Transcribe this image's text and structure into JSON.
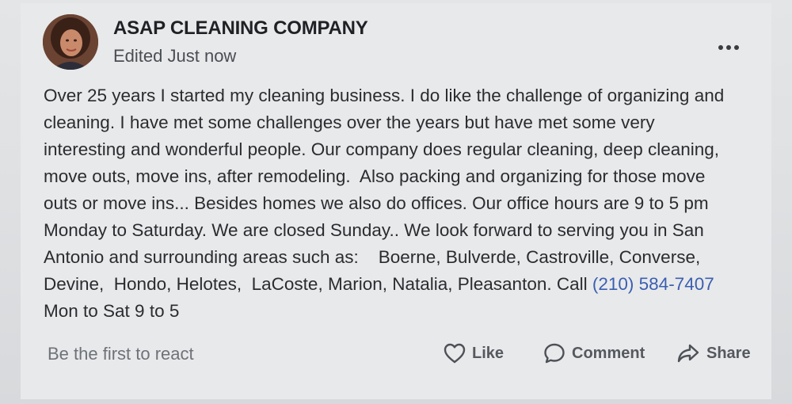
{
  "post": {
    "author_name": "ASAP CLEANING COMPANY",
    "meta": "Edited Just now",
    "body_lines": [
      "Over 25 years I started my cleaning business. I do like the challenge of organizing and",
      "cleaning. I have met some challenges over the years but have met some very",
      "interesting and wonderful people. Our company does regular cleaning, deep cleaning,",
      "move outs, move ins, after remodeling.  Also packing and organizing for those move",
      "outs or move ins... Besides homes we also do offices. Our office hours are 9 to 5 pm",
      "Monday to Saturday. We are closed Sunday.. We look forward to serving you in San",
      "Antonio and surrounding areas such as:    Boerne, Bulverde, Castroville, Converse,",
      "Devine,  Hondo, Helotes,  LaCoste, Marion, Natalia, Pleasanton. Call "
    ],
    "phone": "(210) 584-7407",
    "last_line": "Mon to Sat 9 to 5"
  },
  "footer": {
    "reaction_prompt": "Be the first to react",
    "like_label": "Like",
    "comment_label": "Comment",
    "share_label": "Share"
  },
  "icons": {
    "more": "more-options-icon",
    "like": "heart-icon",
    "comment": "comment-bubble-icon",
    "share": "share-arrow-icon"
  },
  "colors": {
    "link": "#3b5fb0",
    "text": "#2a2c2f",
    "muted": "#6e7277"
  }
}
